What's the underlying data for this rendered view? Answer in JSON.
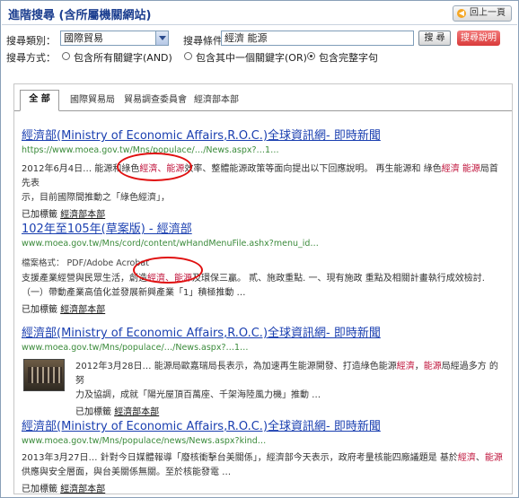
{
  "header": {
    "title": "進階搜尋 (含所屬機關網站)",
    "back_label": "回上一頁"
  },
  "form": {
    "category_label": "搜尋類別：",
    "category_value": "國際貿易",
    "condition_label": "搜尋條件：",
    "condition_value": "經濟 能源",
    "search_button": "搜 尋",
    "help_button": "搜尋說明",
    "mode_label": "搜尋方式：",
    "modes": [
      "包含所有關鍵字(AND)",
      "包含其中一個關鍵字(OR)",
      "包含完整字句"
    ],
    "selected_mode": "包含完整字句"
  },
  "tabs": [
    "全 部",
    "國際貿易局",
    "貿易調查委員會",
    "經濟部本部"
  ],
  "results": [
    {
      "title": "經濟部(Ministry of Economic Affairs,R.O.C.)全球資訊網- 即時新聞",
      "url": "https://www.moea.gov.tw/Mns/populace/…/News.aspx?…1…",
      "snippet_a": "2012年6月4日… 能源和綠色",
      "snippet_hl1": "經濟、能源",
      "snippet_b": "效率、整體能源政策等面向提出以下回應說明。 再生能源和 綠色",
      "snippet_hl2": "經濟 能源",
      "snippet_c": "局首先表",
      "snippet_line2": "示，目前國際間推動之「綠色經濟」，",
      "tag_prefix": "已加標籤",
      "tag_link": "經濟部本部"
    },
    {
      "title": "102年至105年(草案版) - 經濟部",
      "url": "www.moea.gov.tw/Mns/cord/content/wHandMenuFile.ashx?menu_id…",
      "meta": "檔案格式： PDF/Adobe Acrobat",
      "snippet_a": "支援產業經營與民眾生活，創造",
      "snippet_hl1": "經濟、能源",
      "snippet_b": "及環保三贏。 貳、施政重點. 一、現有施政 重點及相關計畫執行成效檢討.",
      "snippet_line2": "（一）帶動產業高值化並發展新興產業「1」積極推動 …",
      "tag_prefix": "已加標籤",
      "tag_link": "經濟部本部"
    },
    {
      "title": "經濟部(Ministry of Economic Affairs,R.O.C.)全球資訊網- 即時新聞",
      "url": "www.moea.gov.tw/Mns/populace/…/News.aspx?…1…",
      "snippet_a": "2012年3月28日… 能源局歐嘉瑞局長表示，為加速再生能源開發、打造綠色能源",
      "snippet_hl1": "經濟",
      "snippet_b": "，",
      "snippet_hl2": "能源",
      "snippet_c": "局經過多方 的努",
      "snippet_line2": "力及協調，成就「陽光屋頂百萬座、千架海陸風力機」推動 …",
      "tag_prefix": "已加標籤",
      "tag_link": "經濟部本部"
    },
    {
      "title": "經濟部(Ministry of Economic Affairs,R.O.C.)全球資訊網- 即時新聞",
      "url": "www.moea.gov.tw/Mns/populace/news/News.aspx?kind…",
      "snippet_a": "2013年3月27日… 針對今日媒體報導「廢核衝擊台美關係」，經濟部今天表示，政府考量核能四廠議題是 基於",
      "snippet_hl1": "經濟",
      "snippet_b": "、",
      "snippet_hl2": "能源",
      "snippet_line2": "供應與安全層面，與台美關係無關。至於核能發電 …",
      "tag_prefix": "已加標籤",
      "tag_link": "經濟部本部"
    }
  ],
  "colors": {
    "title_blue": "#1a3fb0",
    "url_green": "#3a8a3a",
    "highlight": "#c0143c",
    "annotation_red": "#e01010"
  }
}
